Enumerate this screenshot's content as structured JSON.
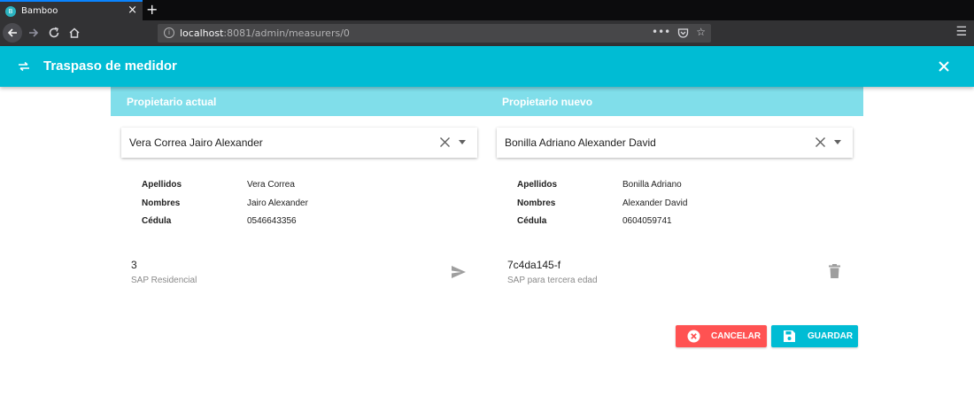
{
  "browser": {
    "tab_title": "Bamboo",
    "favicon_letter": "B",
    "url_host": "localhost",
    "url_rest": ":8081/admin/measurers/0",
    "accent_color": "#0a84ff"
  },
  "header": {
    "title": "Traspaso de medidor",
    "color": "#00bcd4"
  },
  "columns": {
    "current_title": "Propietario actual",
    "new_title": "Propietario nuevo",
    "bar_color": "#80deea"
  },
  "current_owner": {
    "select_value": "Vera Correa Jairo Alexander",
    "details": [
      {
        "label": "Apellidos",
        "value": "Vera Correa"
      },
      {
        "label": "Nombres",
        "value": "Jairo Alexander"
      },
      {
        "label": "Cédula",
        "value": "0546643356"
      }
    ],
    "measurer": {
      "code": "3",
      "description": "SAP Residencial"
    }
  },
  "new_owner": {
    "select_value": "Bonilla Adriano Alexander David",
    "details": [
      {
        "label": "Apellidos",
        "value": "Bonilla Adriano"
      },
      {
        "label": "Nombres",
        "value": "Alexander David"
      },
      {
        "label": "Cédula",
        "value": "0604059741"
      }
    ],
    "measurer": {
      "code": "7c4da145-f",
      "description": "SAP para tercera edad"
    }
  },
  "actions": {
    "cancel_label": "CANCELAR",
    "save_label": "GUARDAR",
    "cancel_color": "#ff5252",
    "save_color": "#00bcd4"
  }
}
